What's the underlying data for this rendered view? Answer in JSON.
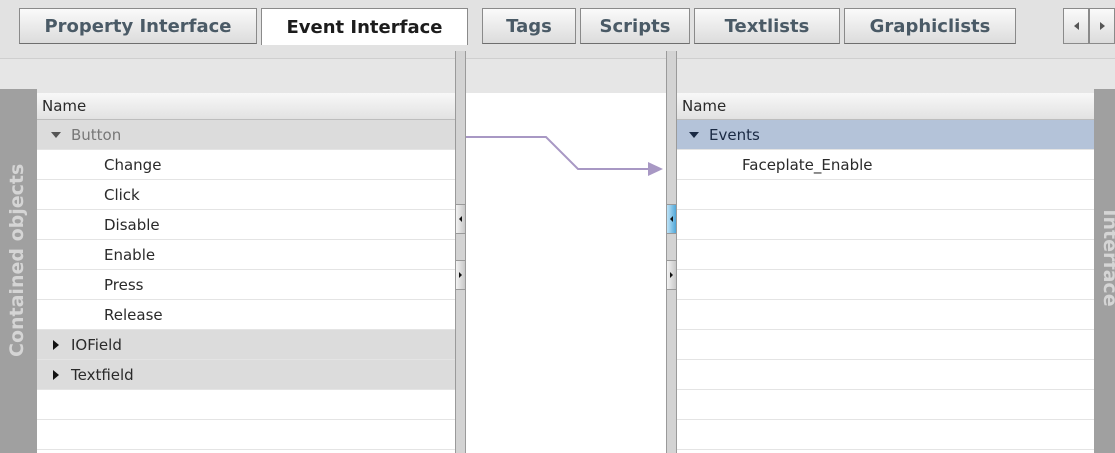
{
  "tabs": [
    {
      "label": "Property Interface",
      "active": false
    },
    {
      "label": "Event Interface",
      "active": true
    },
    {
      "label": "Tags",
      "active": false
    },
    {
      "label": "Scripts",
      "active": false
    },
    {
      "label": "Textlists",
      "active": false
    },
    {
      "label": "Graphiclists",
      "active": false
    }
  ],
  "left_panel": {
    "side_label": "Contained objects",
    "header": "Name",
    "rows": [
      {
        "label": "Button",
        "type": "group-expanded"
      },
      {
        "label": "Change",
        "type": "child"
      },
      {
        "label": "Click",
        "type": "child"
      },
      {
        "label": "Disable",
        "type": "child"
      },
      {
        "label": "Enable",
        "type": "child"
      },
      {
        "label": "Press",
        "type": "child"
      },
      {
        "label": "Release",
        "type": "child"
      },
      {
        "label": "IOField",
        "type": "group-collapsed"
      },
      {
        "label": "Textfield",
        "type": "group-collapsed"
      }
    ]
  },
  "right_panel": {
    "side_label": "Interface",
    "header": "Name",
    "rows": [
      {
        "label": "Events",
        "type": "group-selected"
      },
      {
        "label": "Faceplate_Enable",
        "type": "child"
      }
    ]
  },
  "colors": {
    "connector": "#a898c4",
    "selection": "#b4c3d9",
    "side_bar": "#a0a0a0"
  },
  "icons": [
    "scroll-left-icon",
    "scroll-right-icon",
    "expand-down-icon",
    "collapse-right-icon",
    "connector-arrow-icon"
  ]
}
